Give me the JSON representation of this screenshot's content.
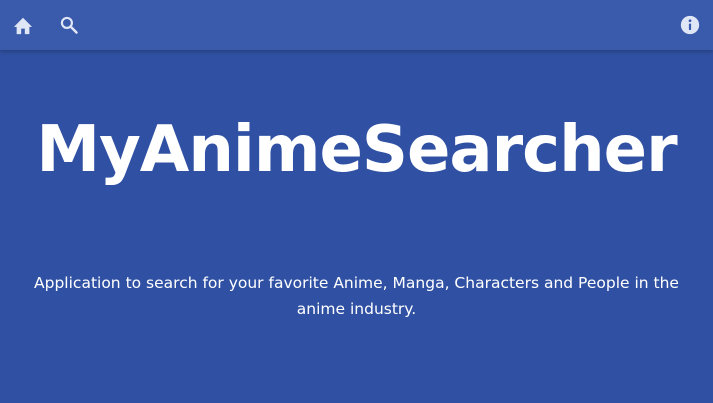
{
  "toolbar": {
    "icons": [
      "home-icon",
      "search-icon",
      "info-icon"
    ],
    "icon_color": "#dfe6f5"
  },
  "hero": {
    "logo_text": "MyAnimeSearcher",
    "tagline": "Application to search for your favorite Anime, Manga, Characters and People in the anime industry."
  },
  "colors": {
    "background": "#3051a3",
    "toolbar": "#3a5aab",
    "text": "#ffffff"
  }
}
